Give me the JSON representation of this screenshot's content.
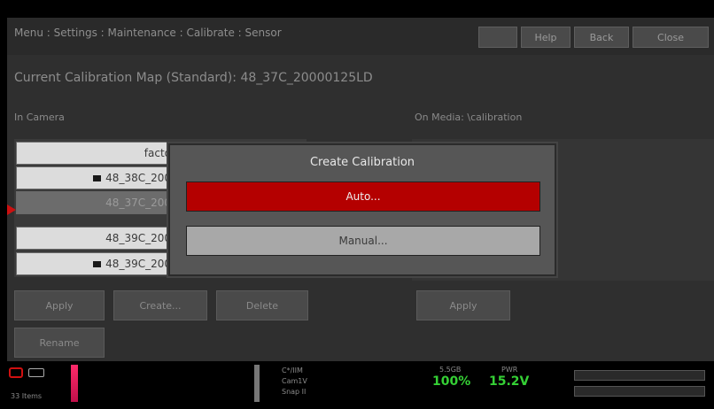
{
  "header": {
    "breadcrumb": "Menu : Settings : Maintenance : Calibrate : Sensor",
    "buttons": [
      "Help",
      "Back",
      "Close"
    ]
  },
  "calibration_map": {
    "label": "Current Calibration Map (Standard):",
    "value": "48_37C_20000125LD"
  },
  "in_camera": {
    "label": "In Camera",
    "items": [
      {
        "text": "facto",
        "icon": false,
        "selected": false
      },
      {
        "text": "48_38C_200",
        "icon": true,
        "selected": false
      },
      {
        "text": "48_37C_200",
        "icon": false,
        "selected": true
      },
      {
        "text": "48_39C_200",
        "icon": false,
        "selected": false
      },
      {
        "text": "48_39C_200",
        "icon": true,
        "selected": false
      }
    ]
  },
  "on_media": {
    "label": "On Media: \\calibration"
  },
  "actions": {
    "apply": "Apply",
    "create": "Create...",
    "delete": "Delete",
    "media_apply": "Apply",
    "rename": "Rename"
  },
  "dialog": {
    "title": "Create Calibration",
    "auto": "Auto...",
    "manual": "Manual..."
  },
  "status": {
    "rec_label": "33 Items",
    "info": [
      "C*/IIM",
      "Cam1V",
      "Snap II"
    ],
    "storage_label": "5.5GB",
    "storage_value": "100%",
    "power_label": "PWR",
    "power_value": "15.2V"
  },
  "colors": {
    "accent_red": "#b40000",
    "status_green": "#35d035"
  }
}
